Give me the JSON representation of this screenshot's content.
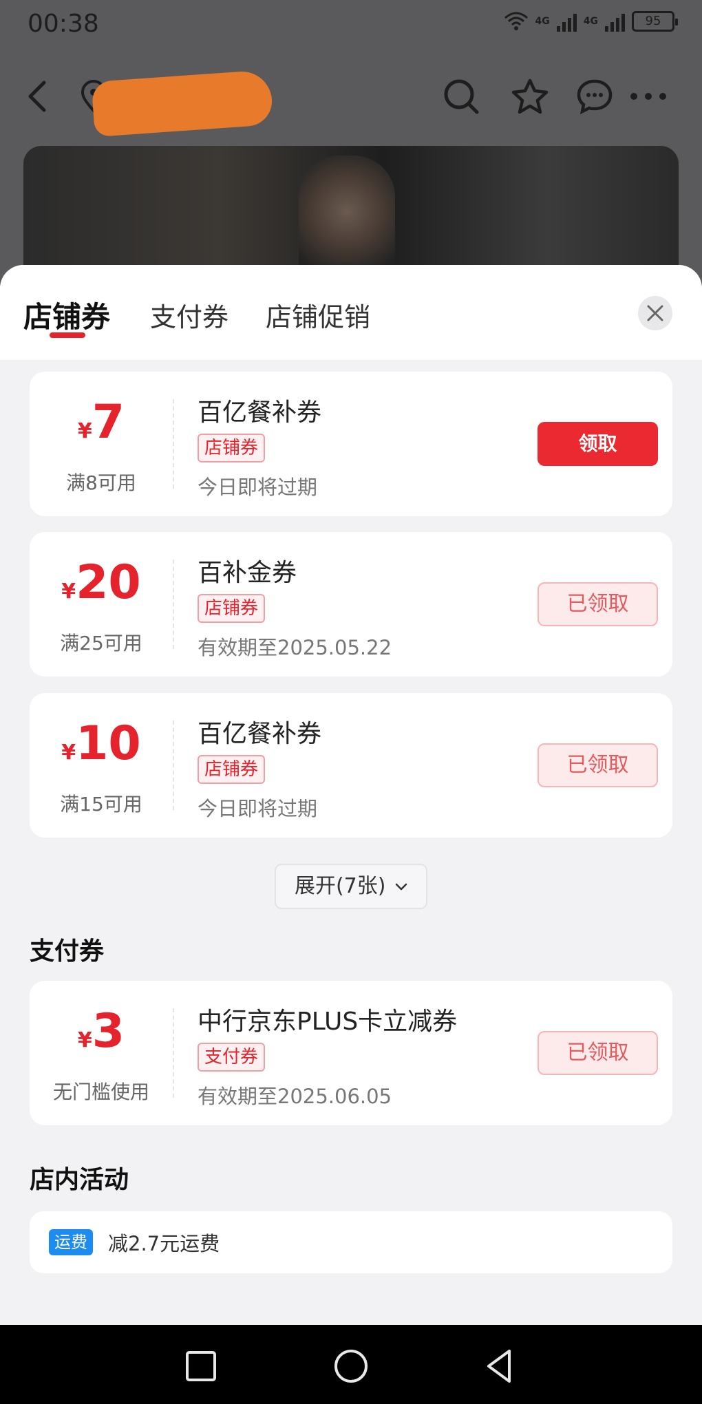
{
  "status": {
    "time": "00:38",
    "signal1": "4G",
    "signal2": "4G",
    "battery": "95"
  },
  "nav": {
    "icons": [
      "back-icon",
      "location-icon",
      "search-icon",
      "star-icon",
      "chat-icon",
      "more-icon"
    ]
  },
  "tabs": [
    {
      "label": "店铺券",
      "active": true
    },
    {
      "label": "支付券",
      "active": false
    },
    {
      "label": "店铺促销",
      "active": false
    }
  ],
  "coupons": [
    {
      "yen": "¥",
      "amount": "7",
      "condition": "满8可用",
      "title": "百亿餐补券",
      "tag": "店铺券",
      "expire": "今日即将过期",
      "button": "领取",
      "claimed": false
    },
    {
      "yen": "¥",
      "amount": "20",
      "condition": "满25可用",
      "title": "百补金券",
      "tag": "店铺券",
      "expire": "有效期至2025.05.22",
      "button": "已领取",
      "claimed": true
    },
    {
      "yen": "¥",
      "amount": "10",
      "condition": "满15可用",
      "title": "百亿餐补券",
      "tag": "店铺券",
      "expire": "今日即将过期",
      "button": "已领取",
      "claimed": true
    }
  ],
  "expand": {
    "label": "展开(7张)"
  },
  "payment_section": {
    "title": "支付券"
  },
  "payment_coupon": {
    "yen": "¥",
    "amount": "3",
    "condition": "无门槛使用",
    "title": "中行京东PLUS卡立减券",
    "tag": "支付券",
    "expire": "有效期至2025.06.05",
    "button": "已领取",
    "claimed": true
  },
  "activity_section": {
    "title": "店内活动"
  },
  "activity": {
    "tag": "运费",
    "text": "减2.7元运费"
  },
  "colors": {
    "accent": "#e5232d",
    "claim_bg": "#ea2930",
    "blue_tag": "#1c8cf0"
  }
}
